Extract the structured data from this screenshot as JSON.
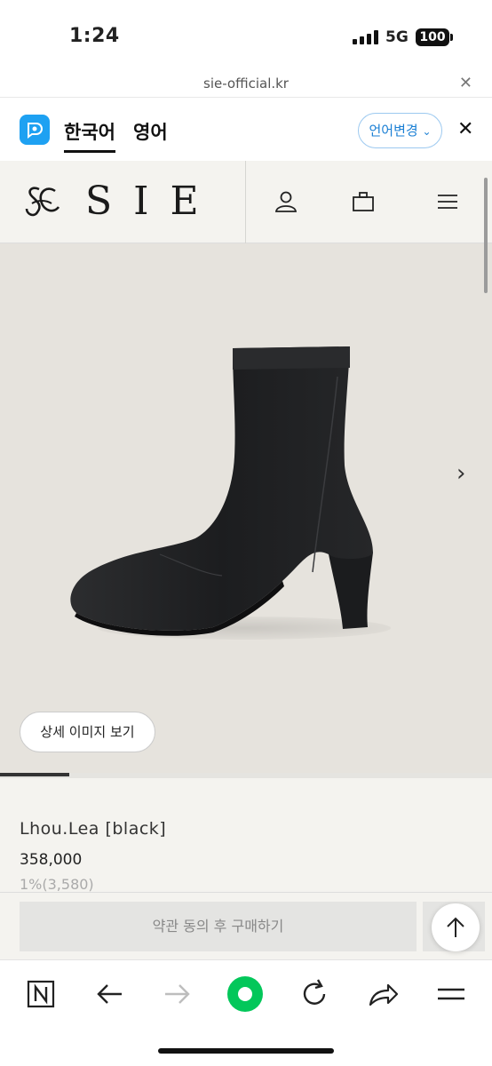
{
  "status_bar": {
    "time": "1:24",
    "network": "5G",
    "battery": "100"
  },
  "browser": {
    "url": "sie-official.kr",
    "close_icon": "close-icon"
  },
  "translate_bar": {
    "lang_current": "한국어",
    "lang_other": "영어",
    "change_button": "언어변경",
    "accent_color": "#1ea1f2"
  },
  "site": {
    "brand": "SIE",
    "icons": [
      "user-icon",
      "bag-icon",
      "menu-icon"
    ]
  },
  "product": {
    "detail_button": "상세 이미지 보기",
    "name": "Lhou.Lea [black]",
    "price": "358,000",
    "point": "1%(3,580)",
    "buy_button": "약관 동의 후 구매하기",
    "image_progress": 0.14
  },
  "toolbar": {
    "icons": [
      "naver-icon",
      "back-arrow-icon",
      "forward-arrow-icon",
      "green-dot-icon",
      "refresh-icon",
      "share-icon",
      "menu-lines-icon"
    ],
    "green": "#03c75a"
  }
}
